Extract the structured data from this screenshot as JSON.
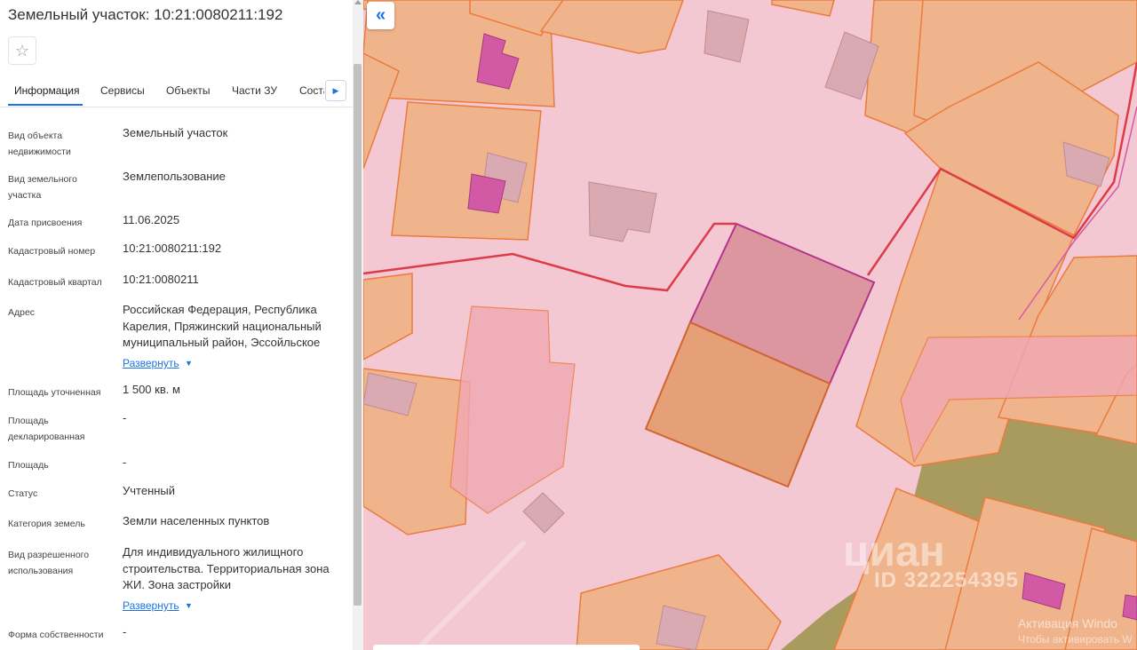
{
  "panel": {
    "title": "Земельный участок: 10:21:0080211:192",
    "favorite_icon": "star-icon",
    "tabs": [
      "Информация",
      "Сервисы",
      "Объекты",
      "Части ЗУ"
    ],
    "tab_clipped": "Состав",
    "tabs_next_icon": "caret-right-icon",
    "expand_label": "Развернуть",
    "rows": [
      {
        "label": "Вид объекта недвижимости",
        "value": "Земельный участок"
      },
      {
        "label": "Вид земельного участка",
        "value": "Землепользование"
      },
      {
        "label": "Дата присвоения",
        "value": "11.06.2025"
      },
      {
        "label": "Кадастровый номер",
        "value": "10:21:0080211:192"
      },
      {
        "label": "Кадастровый квартал",
        "value": "10:21:0080211"
      },
      {
        "label": "Адрес",
        "value": "Российская Федерация, Республика Карелия, Пряжинский национальный муниципальный район, Эссойльское"
      },
      {
        "label": "Площадь уточненная",
        "value": "1 500 кв. м"
      },
      {
        "label": "Площадь декларированная",
        "value": "-"
      },
      {
        "label": "Площадь",
        "value": "-"
      },
      {
        "label": "Статус",
        "value": "Учтенный"
      },
      {
        "label": "Категория земель",
        "value": "Земли населенных пунктов"
      },
      {
        "label": "Вид разрешенного использования",
        "value": "Для индивидуального жилищного строительства. Территориальная зона ЖИ. Зона застройки"
      },
      {
        "label": "Форма собственности",
        "value": "-"
      }
    ]
  },
  "map": {
    "collapse_icon": "double-chevron-left-icon",
    "watermark_logo": "циан",
    "watermark_id": "ID 322254395",
    "windows_activation_title": "Активация Windo",
    "windows_activation_text": "Чтобы активировать W",
    "colors": {
      "background": "#f3c8d2",
      "parcel_fill": "#f0b48c",
      "parcel_stroke": "#ec7a3c",
      "building_fill": "#d9aab2",
      "selected_fill": "#dc96a0",
      "selected_stroke": "#b4348c",
      "boundary": "#dc3c46",
      "forest": "#a09650",
      "magenta_building": "#d25aa5"
    }
  }
}
